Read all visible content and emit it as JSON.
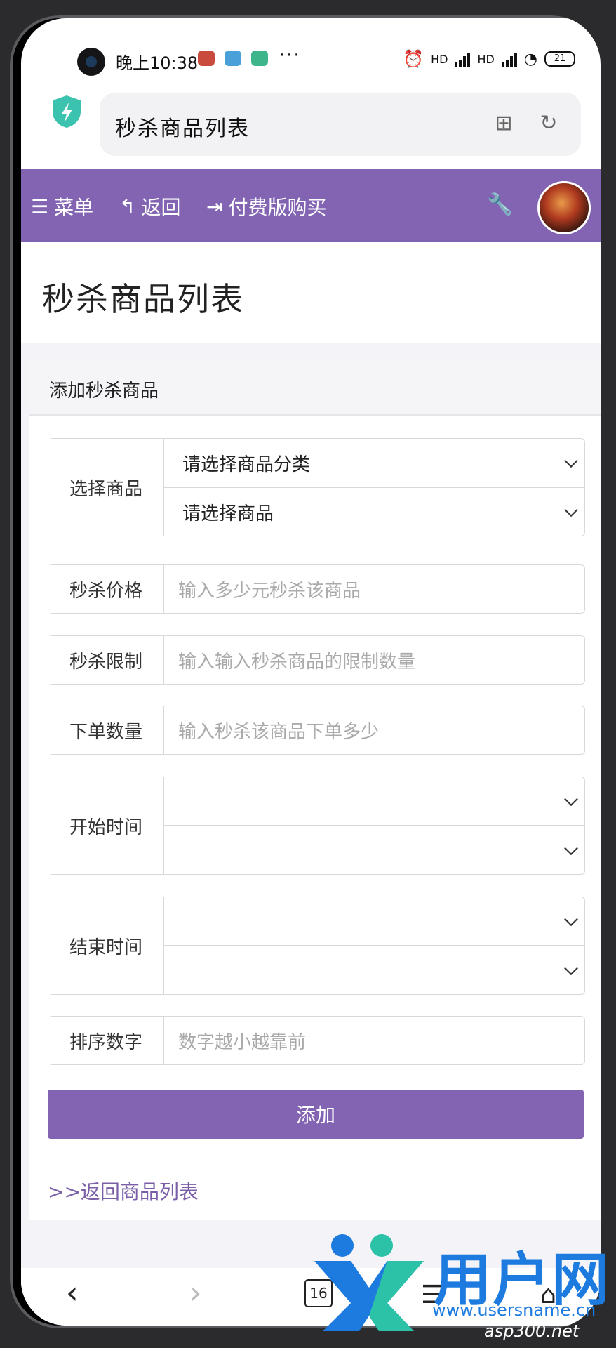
{
  "status_bar": {
    "time": "晚上10:38",
    "more": "···",
    "signal1": "HD",
    "signal2": "HD",
    "battery": "21"
  },
  "browser": {
    "address_title": "秒杀商品列表",
    "tab_count": "16"
  },
  "nav": {
    "menu": "菜单",
    "back": "返回",
    "buy": "付费版购买"
  },
  "page": {
    "title": "秒杀商品列表"
  },
  "card": {
    "title": "添加秒杀商品",
    "form": {
      "select_product": {
        "label": "选择商品",
        "category_select": "请选择商品分类",
        "product_select": "请选择商品"
      },
      "price": {
        "label": "秒杀价格",
        "placeholder": "输入多少元秒杀该商品"
      },
      "limit": {
        "label": "秒杀限制",
        "placeholder": "输入输入秒杀商品的限制数量"
      },
      "order_qty": {
        "label": "下单数量",
        "placeholder": "输入秒杀该商品下单多少"
      },
      "start_time": {
        "label": "开始时间"
      },
      "end_time": {
        "label": "结束时间"
      },
      "sort": {
        "label": "排序数字",
        "placeholder": "数字越小越靠前"
      },
      "submit": "添加"
    },
    "back_link": ">>返回商品列表"
  },
  "watermark": {
    "text": "用户网",
    "url": "www.usersname.cn",
    "url2": "asp300.net"
  },
  "colors": {
    "accent": "#8264b2",
    "link": "#7a5fa8"
  }
}
